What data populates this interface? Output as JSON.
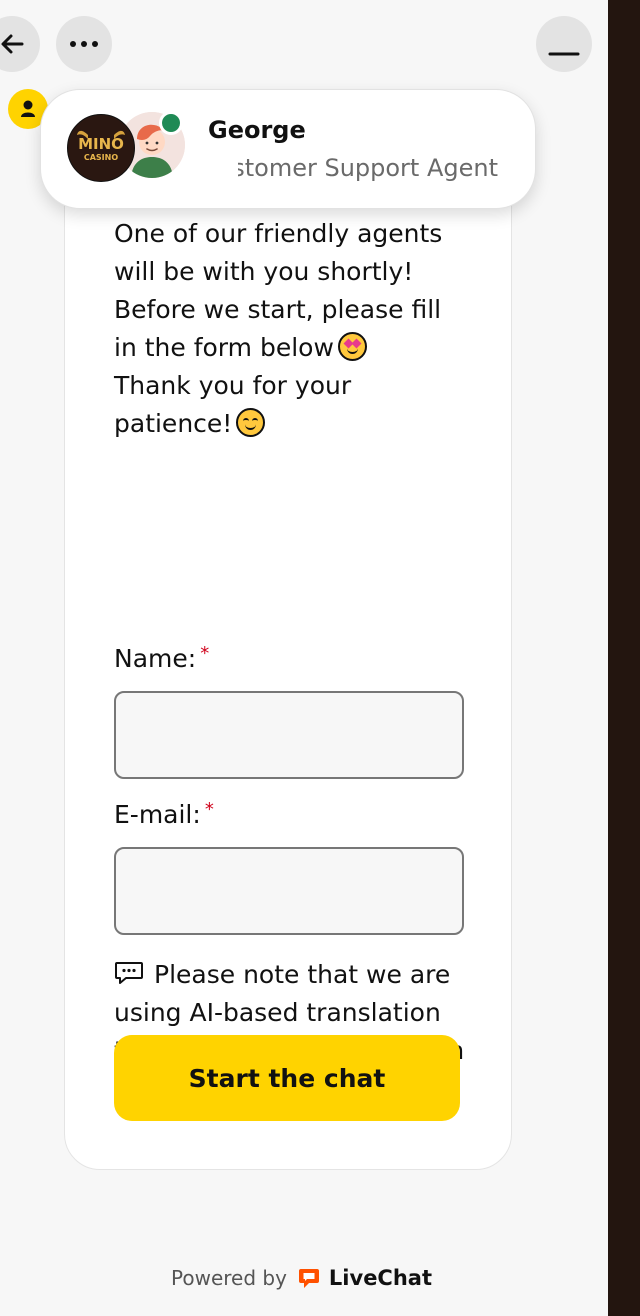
{
  "header": {
    "back_icon": "arrow-left-icon",
    "more_icon": "three-dots-icon",
    "minimize_icon": "minimize-icon"
  },
  "agent": {
    "name": "George",
    "role": "Customer Support Agent",
    "logo_text_top": "MINO",
    "logo_text_bottom": "CASINO",
    "online_color": "#1f8a55"
  },
  "message": {
    "line_1": "One of our friendly agents will be with you shortly!",
    "line_2": "Before we start, please fill in the form below",
    "line_3": "Thank you for your patience!"
  },
  "form": {
    "name_label": "Name:",
    "email_label": "E-mail:",
    "required_marker": "*",
    "name_value": "",
    "email_value": "",
    "note": "Please note that we are using AI-based translation to ensure communication in your preferred language.",
    "submit_label": "Start the chat"
  },
  "footer": {
    "powered_by": "Powered by",
    "brand": "LiveChat"
  },
  "colors": {
    "accent": "#ffd300",
    "required": "#d0021b",
    "right_panel": "#23150f",
    "brand": "#ff5100"
  }
}
